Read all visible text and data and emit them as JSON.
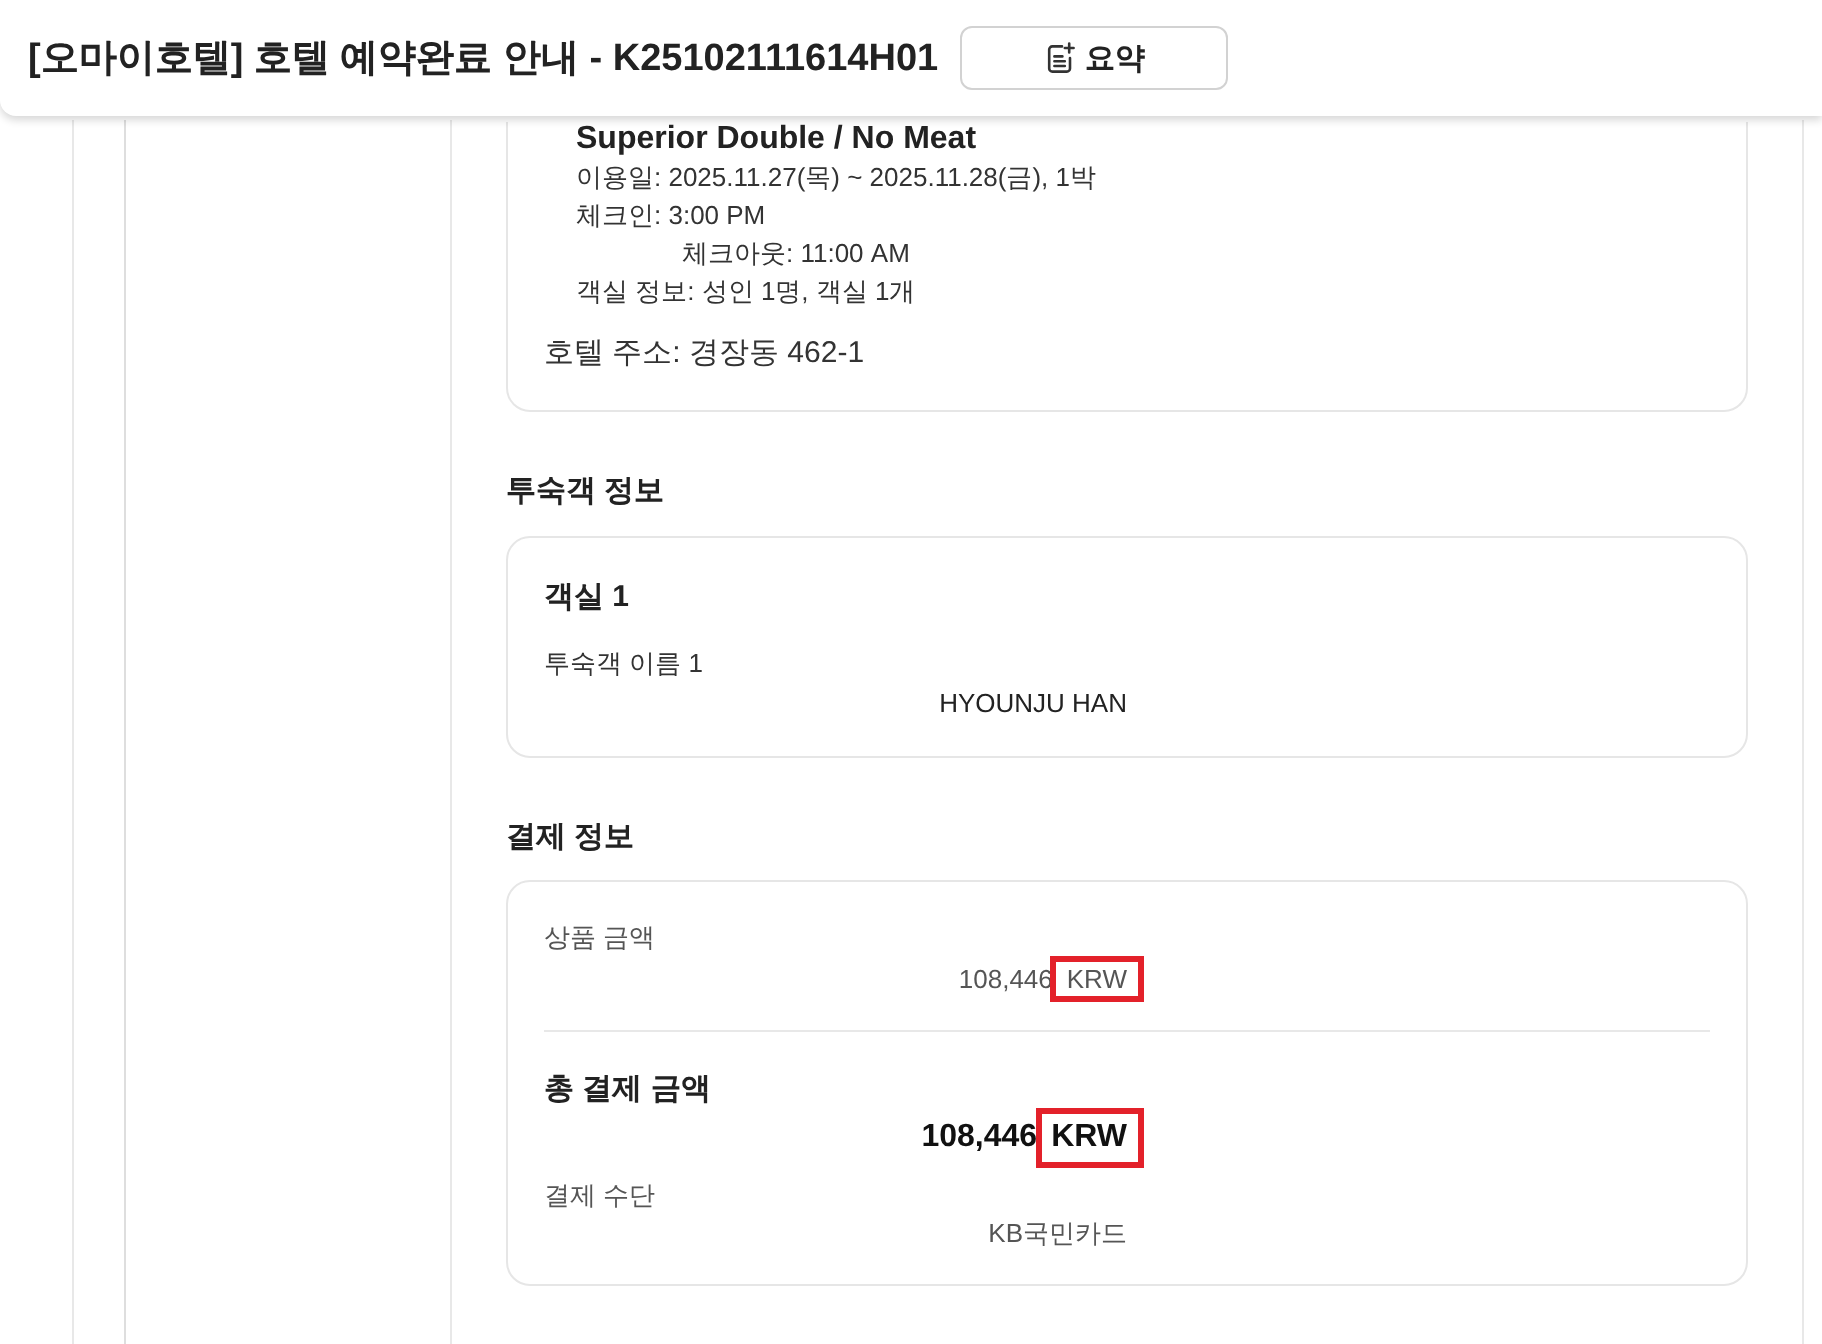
{
  "header": {
    "title": "[오마이호텔] 호텔 예약완료 안내 - K25102111614H01",
    "summary_button": "요약"
  },
  "booking_card": {
    "room_name": "Superior Double / No Meat",
    "details": [
      {
        "kind": "line",
        "text": "이용일: 2025.11.27(목) ~ 2025.11.28(금), 1박"
      },
      {
        "kind": "line",
        "text": "체크인: 3:00 PM"
      },
      {
        "kind": "indented",
        "text": "체크아웃: 11:00 AM"
      },
      {
        "kind": "line",
        "text": "객실 정보: 성인 1명, 객실 1개"
      }
    ],
    "address": "호텔 주소: 경장동 462-1"
  },
  "guest_section": {
    "heading": "투숙객 정보",
    "rooms": [
      {
        "title": "객실 1",
        "fields": [
          {
            "label": "투숙객 이름 1",
            "value": "HYOUNJU HAN"
          }
        ]
      }
    ]
  },
  "payment_section": {
    "heading": "결제 정보",
    "groups": [
      {
        "rows": [
          {
            "kind": "amount",
            "label": "상품 금액",
            "amount": "108,446",
            "currency": "KRW",
            "highlighted": true
          }
        ]
      },
      {
        "rows": [
          {
            "kind": "total",
            "label": "총 결제 금액",
            "amount": "108,446",
            "currency": "KRW",
            "highlighted": true
          },
          {
            "kind": "text",
            "label": "결제 수단",
            "value": "KB국민카드"
          }
        ]
      }
    ]
  }
}
